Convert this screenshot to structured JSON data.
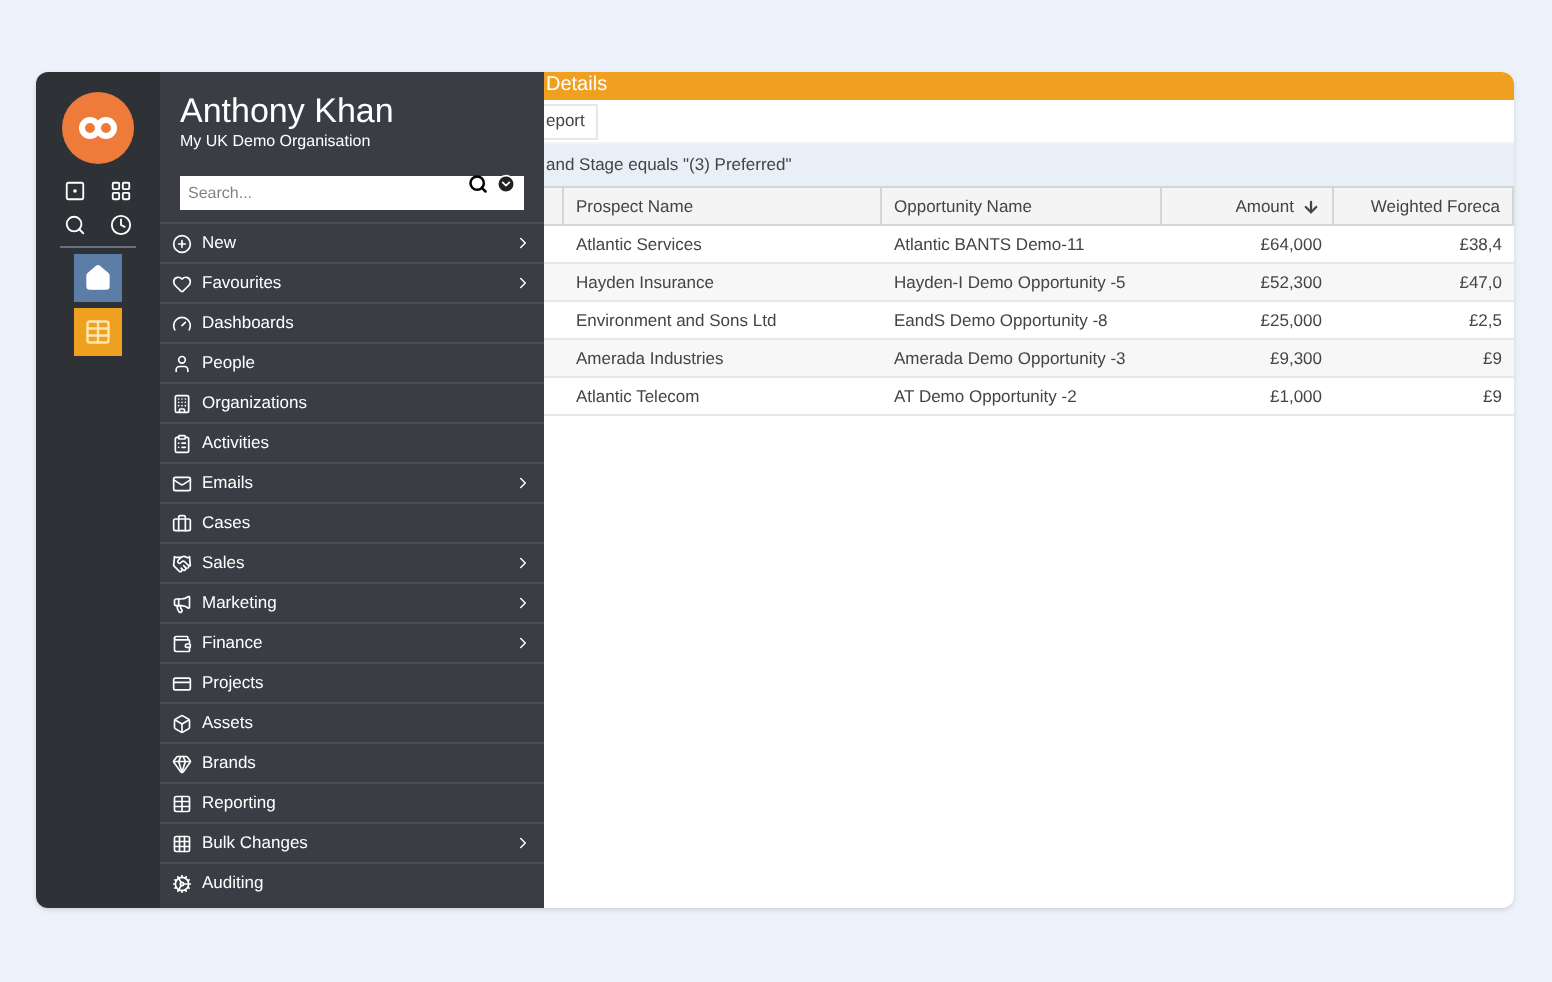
{
  "user": {
    "name": "Anthony Khan",
    "organisation": "My UK Demo Organisation"
  },
  "search": {
    "placeholder": "Search..."
  },
  "menu": [
    {
      "label": "New",
      "submenu": true
    },
    {
      "label": "Favourites",
      "submenu": true
    },
    {
      "label": "Dashboards",
      "submenu": false
    },
    {
      "label": "People",
      "submenu": false
    },
    {
      "label": "Organizations",
      "submenu": false
    },
    {
      "label": "Activities",
      "submenu": false
    },
    {
      "label": "Emails",
      "submenu": true
    },
    {
      "label": "Cases",
      "submenu": false
    },
    {
      "label": "Sales",
      "submenu": true
    },
    {
      "label": "Marketing",
      "submenu": true
    },
    {
      "label": "Finance",
      "submenu": true
    },
    {
      "label": "Projects",
      "submenu": false
    },
    {
      "label": "Assets",
      "submenu": false
    },
    {
      "label": "Brands",
      "submenu": false
    },
    {
      "label": "Reporting",
      "submenu": false
    },
    {
      "label": "Bulk Changes",
      "submenu": true
    },
    {
      "label": "Auditing",
      "submenu": false
    }
  ],
  "panel": {
    "title": "Details",
    "tab": "eport",
    "filter": "and Stage equals \"(3) Preferred\""
  },
  "table": {
    "columns": [
      {
        "label": "Prospect Name",
        "sorted": false
      },
      {
        "label": "Opportunity Name",
        "sorted": false
      },
      {
        "label": "Amount",
        "sorted": true
      },
      {
        "label": "Weighted Foreca",
        "sorted": false
      }
    ],
    "rows": [
      [
        "Atlantic Services",
        "Atlantic BANTS Demo-11",
        "£64,000",
        "£38,4"
      ],
      [
        "Hayden Insurance",
        "Hayden-I Demo Opportunity -5",
        "£52,300",
        "£47,0"
      ],
      [
        "Environment and Sons Ltd",
        "EandS Demo Opportunity -8",
        "£25,000",
        "£2,5"
      ],
      [
        "Amerada Industries",
        "Amerada Demo Opportunity -3",
        "£9,300",
        "£9"
      ],
      [
        "Atlantic Telecom",
        "AT Demo Opportunity -2",
        "£1,000",
        "£9"
      ]
    ]
  }
}
